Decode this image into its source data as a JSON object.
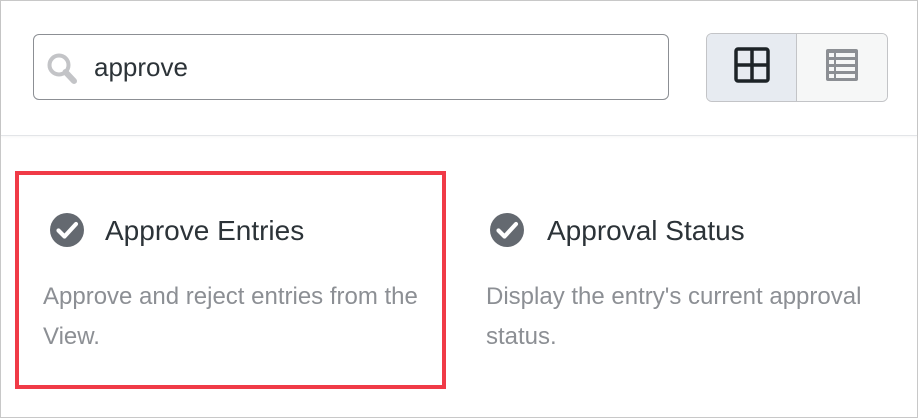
{
  "search": {
    "value": "approve",
    "icon": "search-icon"
  },
  "view_toggle": {
    "options": [
      {
        "icon": "grid-view-icon",
        "active": true
      },
      {
        "icon": "list-view-icon",
        "active": false
      }
    ]
  },
  "results": [
    {
      "icon": "check-circle-icon",
      "title": "Approve Entries",
      "description": "Approve and reject entries from the View.",
      "highlighted": true
    },
    {
      "icon": "check-circle-icon",
      "title": "Approval Status",
      "description": "Display the entry's current approval status.",
      "highlighted": false
    }
  ],
  "colors": {
    "highlight_border": "#f03a47",
    "icon": "#646970",
    "title_text": "#2c3338",
    "description_text": "#8c8f94"
  }
}
